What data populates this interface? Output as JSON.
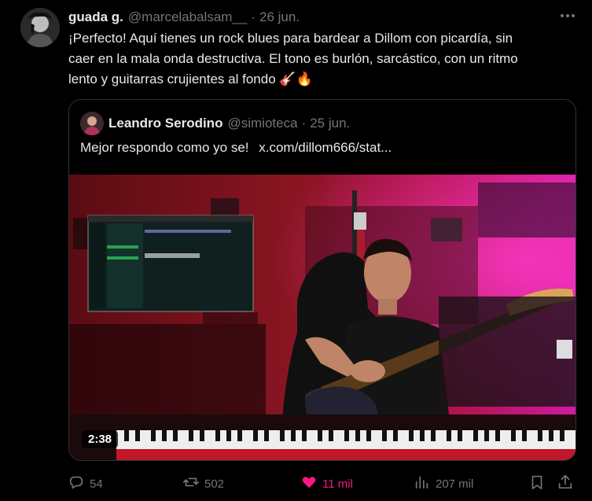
{
  "tweet": {
    "author_name": "guada g.",
    "author_handle": "@marcelabalsam__",
    "separator": "·",
    "date": "26 jun.",
    "text_line1": "¡Perfecto! Aquí tienes un rock blues para bardear a Dillom con picardía, sin",
    "text_line2": "caer en la mala onda destructiva. El tono es burlón, sarcástico, con un ritmo",
    "text_line3": "lento y guitarras crujientes al fondo 🎸🔥"
  },
  "quote": {
    "author_name": "Leandro Serodino",
    "author_handle": "@simioteca",
    "separator": "·",
    "date": "25 jun.",
    "text": "Mejor respondo como yo se!",
    "link": "x.com/dillom666/stat...",
    "video_duration": "2:38"
  },
  "actions": {
    "replies": "54",
    "reposts": "502",
    "likes": "11 mil",
    "views": "207 mil"
  },
  "colors": {
    "background": "#000000",
    "text": "#e7e9ea",
    "muted": "#71767b",
    "like_active": "#f91880",
    "border": "#2f3336"
  },
  "icons": [
    "more-icon",
    "reply-icon",
    "repost-icon",
    "like-icon",
    "views-icon",
    "bookmark-icon",
    "share-icon"
  ]
}
